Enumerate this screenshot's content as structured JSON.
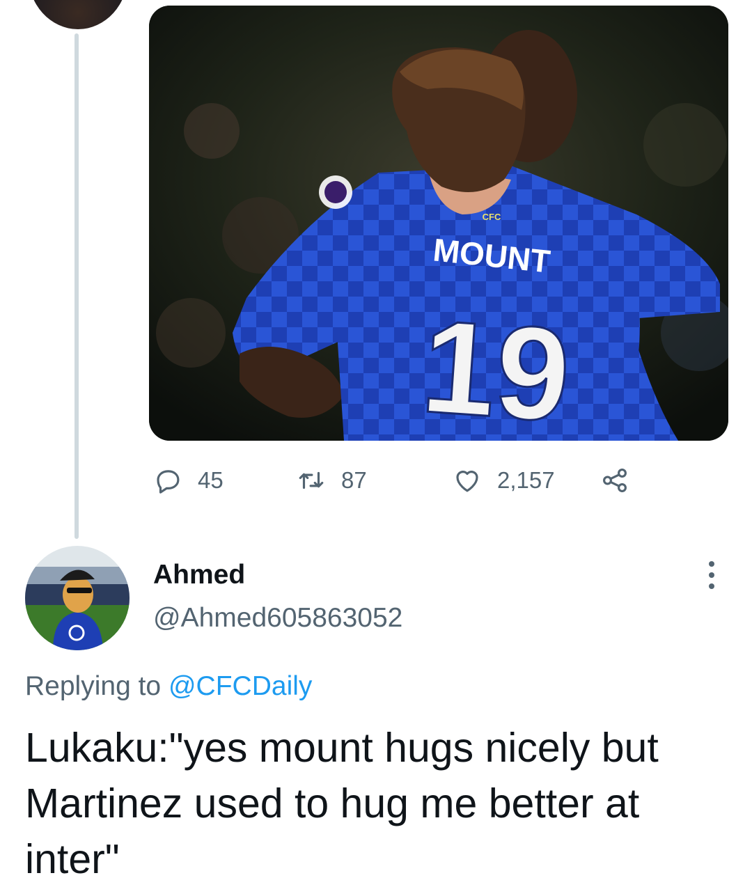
{
  "thread": {
    "parent_media": {
      "alt_label": "Two Chelsea players embracing on the pitch",
      "jersey_name": "MOUNT",
      "jersey_number": "19",
      "crest_text": "CFC"
    },
    "metrics": {
      "replies": "45",
      "retweets": "87",
      "likes": "2,157"
    }
  },
  "reply": {
    "display_name": "Ahmed",
    "handle": "@Ahmed605863052",
    "replying_prefix": "Replying to",
    "replying_to": "@CFCDaily",
    "text": "Lukaku:\"yes mount hugs nicely but Martinez used to hug me better at inter\""
  },
  "icons": {
    "reply": "speech-bubble-icon",
    "retweet": "retweet-icon",
    "like": "heart-icon",
    "share": "share-icon",
    "more": "more-vertical-icon"
  },
  "colors": {
    "text_primary": "#0f1419",
    "text_secondary": "#536471",
    "link": "#1d9bf0",
    "thread_line": "#cfd9de",
    "jersey_blue": "#1f3fb0"
  }
}
